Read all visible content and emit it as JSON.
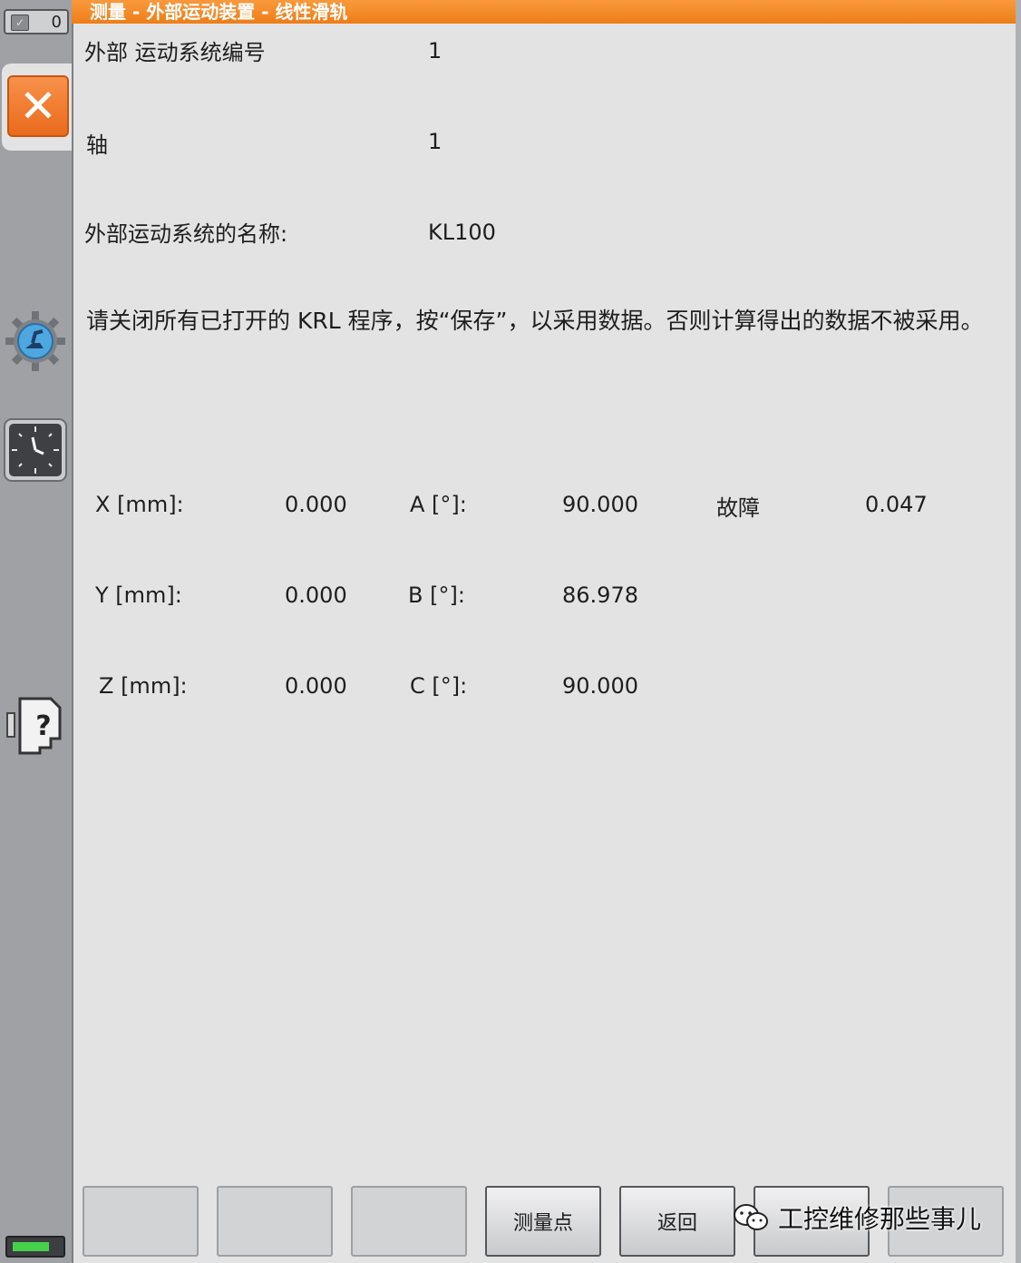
{
  "window": {
    "title": "测量 - 外部运动装置 - 线性滑轨"
  },
  "sidebar": {
    "counter_value": "0"
  },
  "fields": {
    "system_number_label": "外部 运动系统编号",
    "system_number_value": "1",
    "axis_label": "轴",
    "axis_value": "1",
    "name_label": "外部运动系统的名称:",
    "name_value": "KL100"
  },
  "message": "请关闭所有已打开的 KRL 程序，按“保存”，以采用数据。否则计算得出的数据不被采用。",
  "results": {
    "x_label": "X [mm]:",
    "x_value": "0.000",
    "y_label": "Y [mm]:",
    "y_value": "0.000",
    "z_label": "Z [mm]:",
    "z_value": "0.000",
    "a_label": "A [°]:",
    "a_value": "90.000",
    "b_label": "B [°]:",
    "b_value": "86.978",
    "c_label": "C [°]:",
    "c_value": "90.000",
    "fault_label": "故障",
    "fault_value": "0.047"
  },
  "softkeys": {
    "measure_point": "测量点",
    "back": "返回"
  },
  "watermark": "工控维修那些事儿",
  "battery_level": 0.8,
  "colors": {
    "accent": "#ee7d17",
    "background": "#e3e3e4",
    "sidebar": "#9fa1a4"
  }
}
